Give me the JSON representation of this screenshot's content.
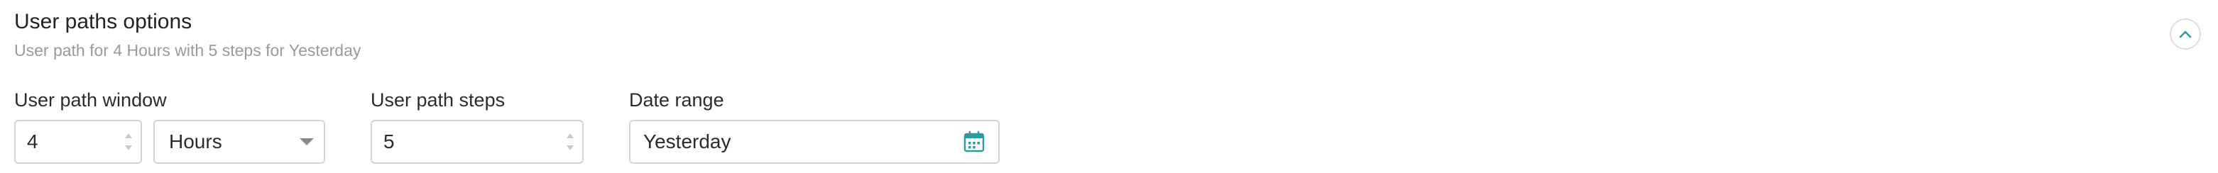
{
  "header": {
    "title": "User paths options",
    "subtitle": "User path for 4 Hours with 5 steps for Yesterday",
    "collapse_icon": "chevron-up-icon"
  },
  "fields": {
    "window_label": "User path window",
    "window_value": "4",
    "window_unit": "Hours",
    "steps_label": "User path steps",
    "steps_value": "5",
    "date_label": "Date range",
    "date_value": "Yesterday",
    "date_icon": "calendar-icon"
  },
  "colors": {
    "accent": "#2a9aa3",
    "title_text": "#222222",
    "subtitle_text": "#9a9a9a",
    "border": "#d4d4d4"
  }
}
